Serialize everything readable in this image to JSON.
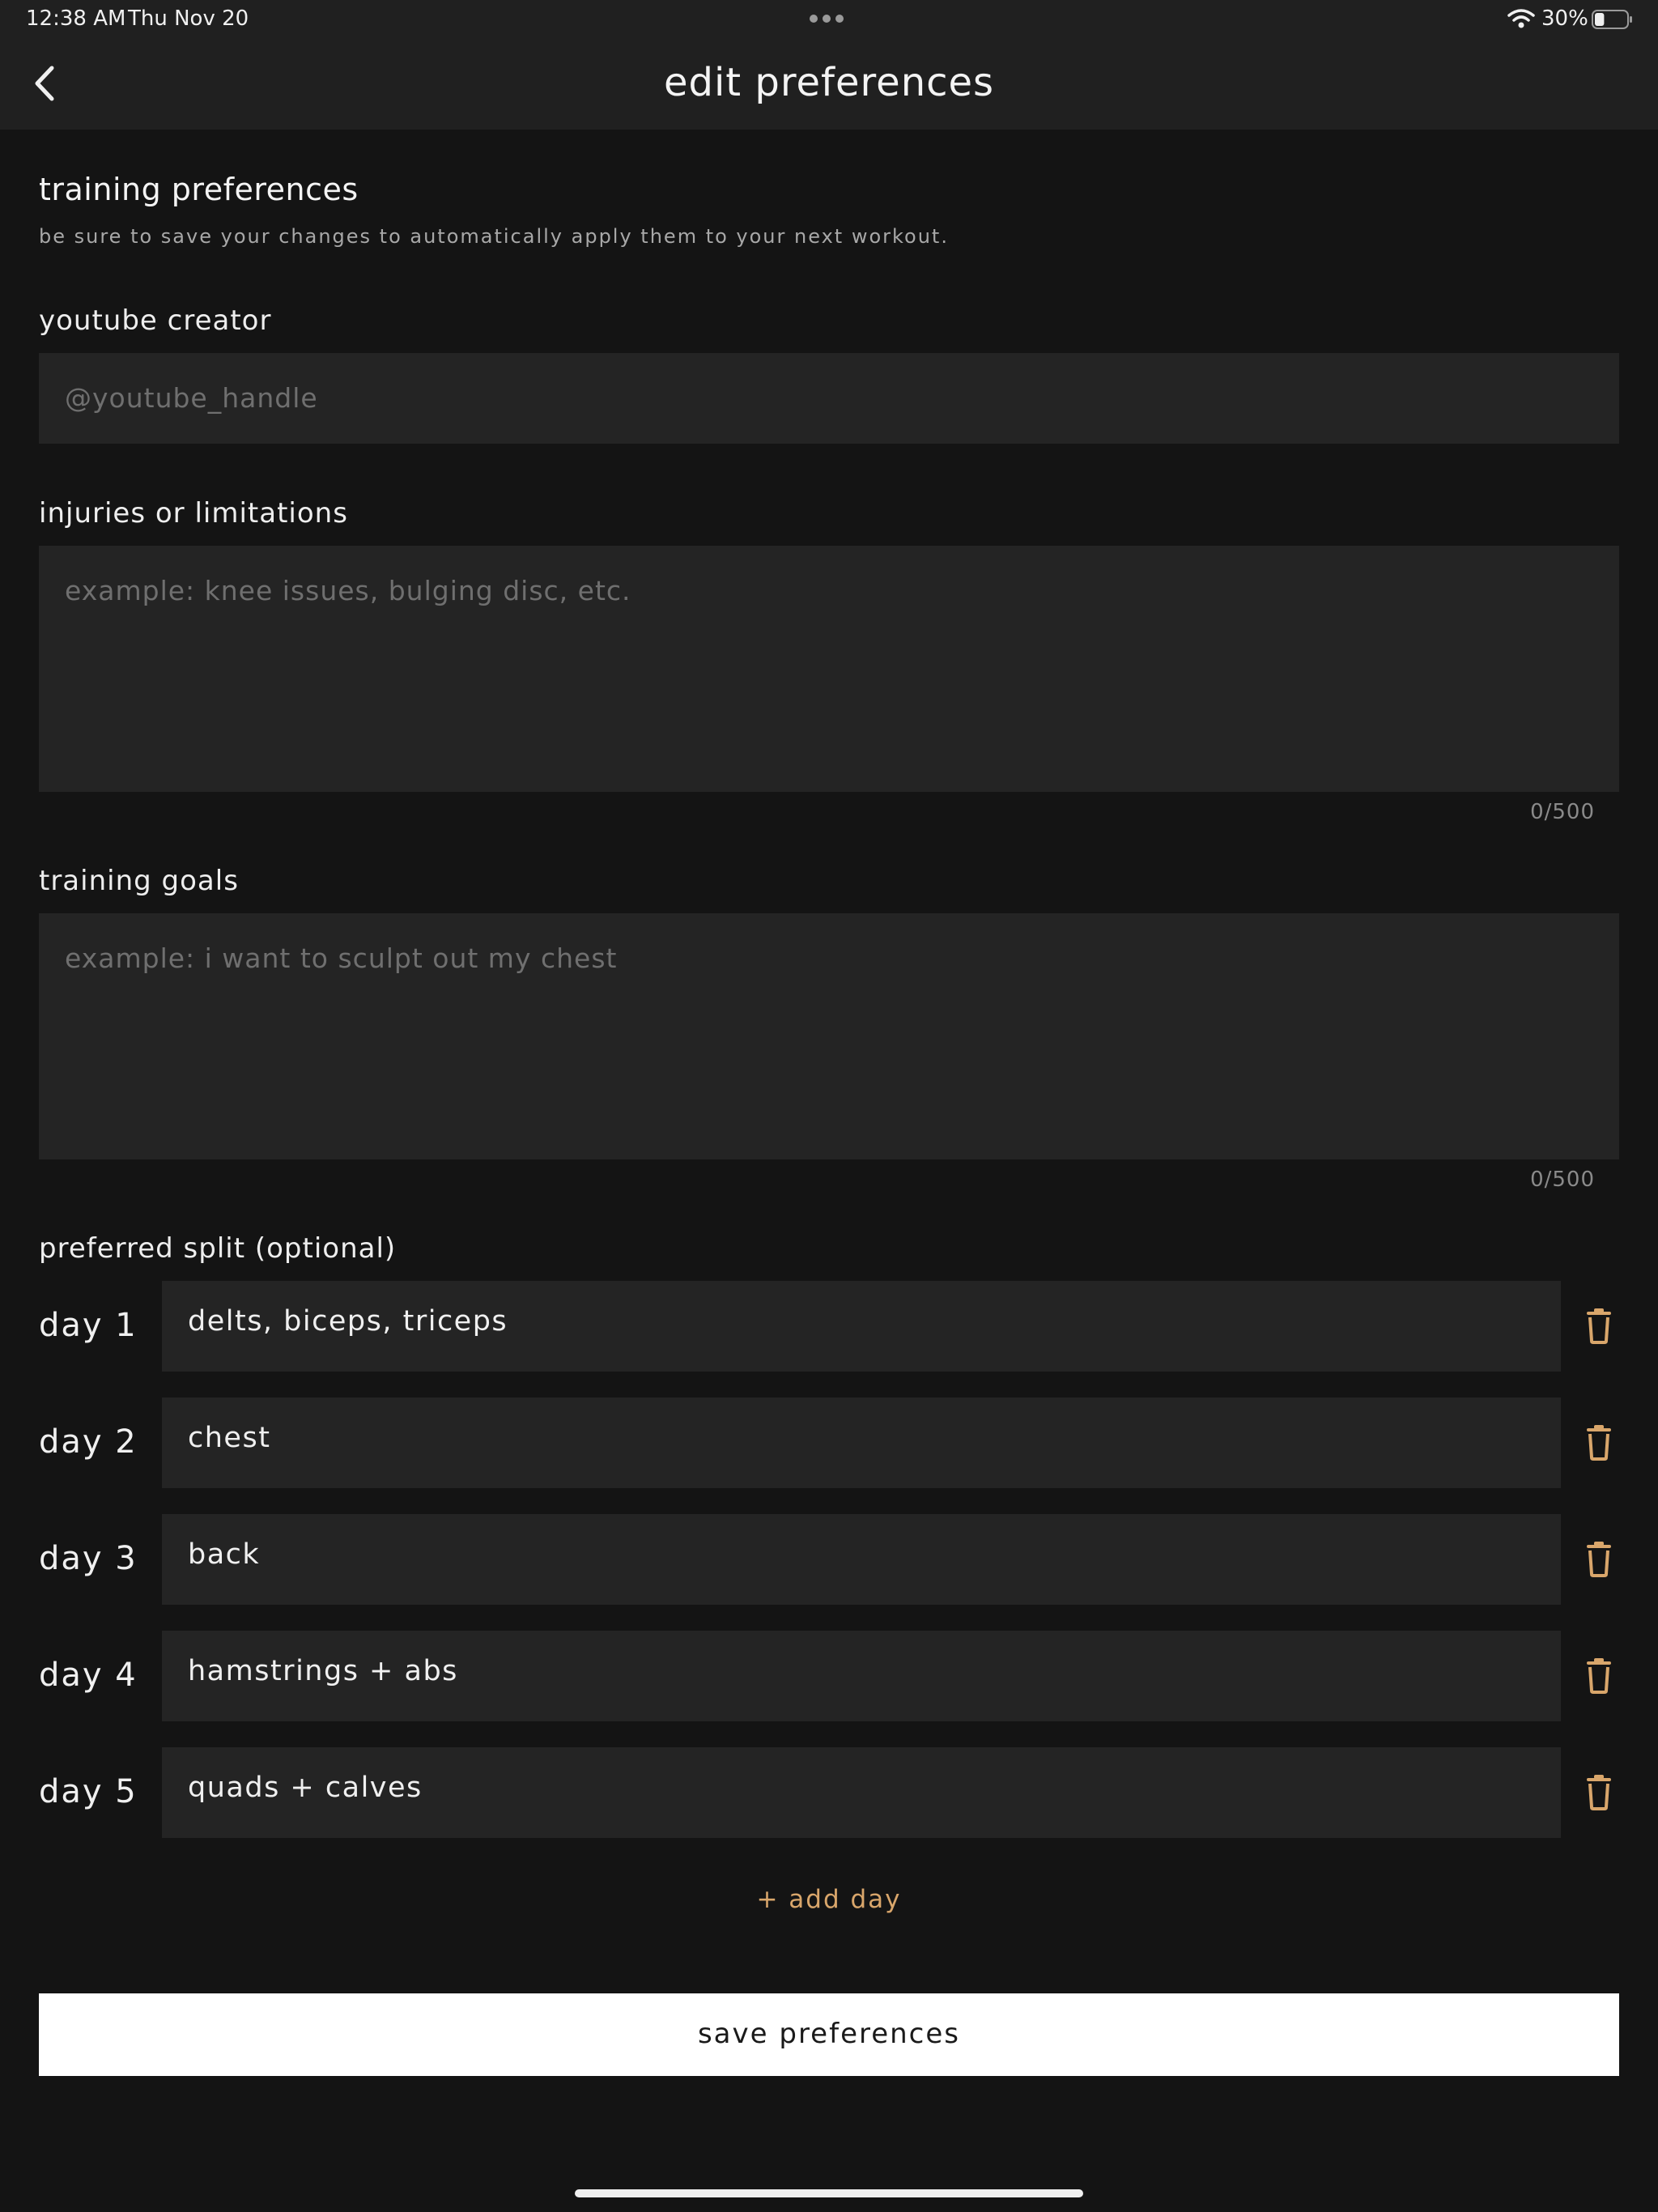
{
  "status_bar": {
    "time": "12:38 AM",
    "date": "Thu Nov 20",
    "battery_percent": "30%",
    "battery_level": 0.3,
    "icons": [
      "more-dots-icon",
      "wifi-icon",
      "battery-icon"
    ]
  },
  "header": {
    "title": "edit preferences",
    "back_icon": "chevron-left-icon"
  },
  "section": {
    "title": "training preferences",
    "subtitle": "be sure to save your changes to automatically apply them to your next workout."
  },
  "youtube": {
    "label": "youtube creator",
    "value": "",
    "placeholder": "@youtube_handle"
  },
  "injuries": {
    "label": "injuries or limitations",
    "value": "",
    "placeholder": "example: knee issues, bulging disc, etc.",
    "counter": "0/500"
  },
  "goals": {
    "label": "training goals",
    "value": "",
    "placeholder": "example: i want to sculpt out my chest",
    "counter": "0/500"
  },
  "split": {
    "label": "preferred split (optional)",
    "days": [
      {
        "label": "day 1",
        "value": "delts, biceps, triceps"
      },
      {
        "label": "day 2",
        "value": "chest"
      },
      {
        "label": "day 3",
        "value": "back"
      },
      {
        "label": "day 4",
        "value": "hamstrings + abs"
      },
      {
        "label": "day 5",
        "value": "quads + calves"
      }
    ],
    "delete_icon": "trash-icon",
    "add_label": "+ add day"
  },
  "save": {
    "label": "save preferences"
  },
  "colors": {
    "background": "#141414",
    "bar": "#202020",
    "field": "#242424",
    "accent": "#d9a66b",
    "button": "#ffffff"
  }
}
